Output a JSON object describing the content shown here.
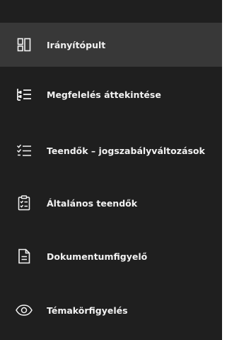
{
  "sidebar": {
    "items": [
      {
        "label": "Irányítópult",
        "icon": "dashboard-icon",
        "active": true
      },
      {
        "label": "Megfelelés áttekintése",
        "icon": "compliance-list-icon",
        "active": false
      },
      {
        "label": "Teendők – jogszabályváltozások",
        "icon": "checklist-icon",
        "active": false
      },
      {
        "label": "Általános teendők",
        "icon": "clipboard-check-icon",
        "active": false
      },
      {
        "label": "Dokumentumfigyelő",
        "icon": "document-icon",
        "active": false
      },
      {
        "label": "Témakörfigyelés",
        "icon": "eye-icon",
        "active": false
      }
    ]
  },
  "colors": {
    "sidebar_background": "#1f1f1f",
    "active_background": "#383838",
    "text": "#f2f2f2"
  }
}
